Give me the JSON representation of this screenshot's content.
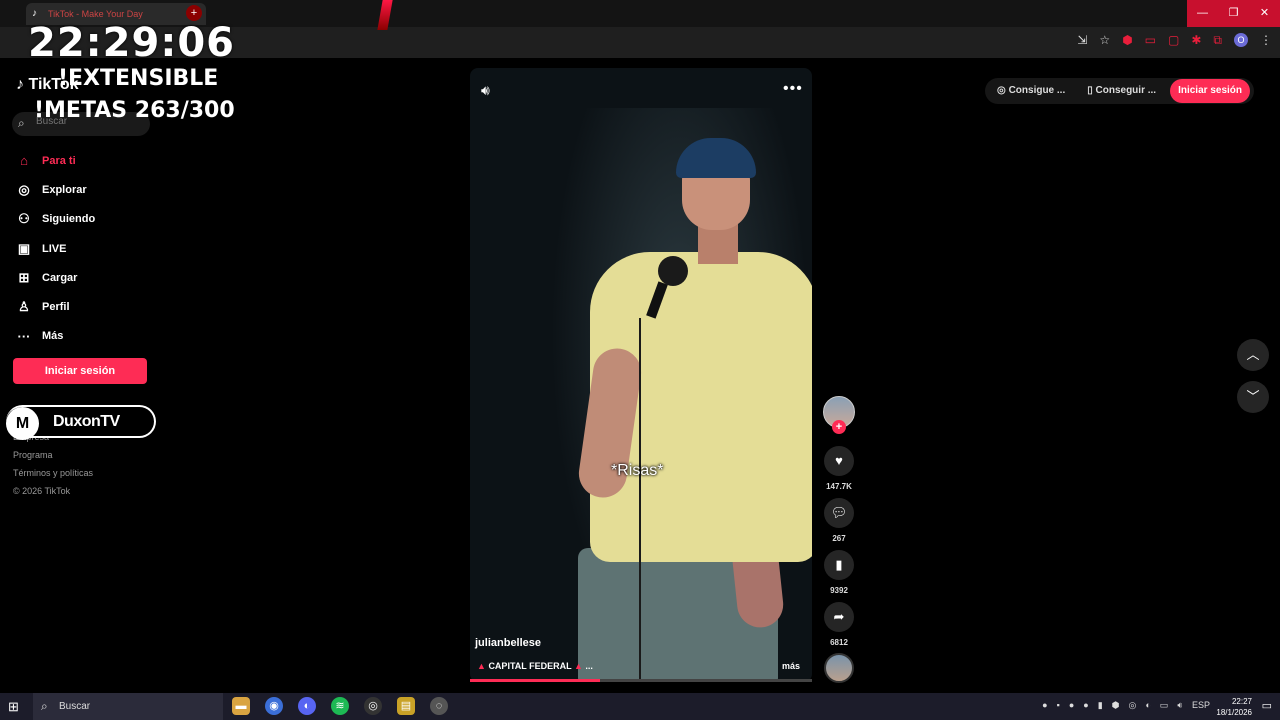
{
  "browser": {
    "tab_title": "TikTok - Make Your Day",
    "window_buttons": [
      "—",
      "❐",
      "✕"
    ]
  },
  "overlay": {
    "clock": "22:29:06",
    "extensible": "!EXTENSIBLE",
    "metas": "!METAS 263/300"
  },
  "tiktok": {
    "logo": "TikTok",
    "search_placeholder": "Buscar",
    "nav": [
      {
        "label": "Para ti",
        "icon": "⌂"
      },
      {
        "label": "Explorar",
        "icon": "◎"
      },
      {
        "label": "Siguiendo",
        "icon": "⚇"
      },
      {
        "label": "LIVE",
        "icon": "▣"
      },
      {
        "label": "Cargar",
        "icon": "⊞"
      },
      {
        "label": "Perfil",
        "icon": "♙"
      },
      {
        "label": "Más",
        "icon": "···"
      }
    ],
    "login_button": "Iniciar sesión",
    "footer": [
      "Empresa",
      "Programa",
      "Términos y políticas",
      "© 2026 TikTok"
    ]
  },
  "streamer": {
    "badge": "M",
    "name": "DuxonTV"
  },
  "top_right": {
    "btn1": "Consigue ...",
    "btn2": "Conseguir ...",
    "login": "Iniciar sesión"
  },
  "video": {
    "subtitle": "*Risas*",
    "author": "julianbellese",
    "caption": "CAPITAL FEDERAL",
    "caption_suffix": "...",
    "more": "más",
    "progress": 0.38
  },
  "actions": {
    "likes": "147.7K",
    "comments": "267",
    "saves": "9392",
    "shares": "6812"
  },
  "taskbar": {
    "search": "Buscar",
    "lang": "ESP",
    "time": "22:27",
    "date": "18/1/2026"
  },
  "colors": {
    "accent": "#fe2c55"
  }
}
